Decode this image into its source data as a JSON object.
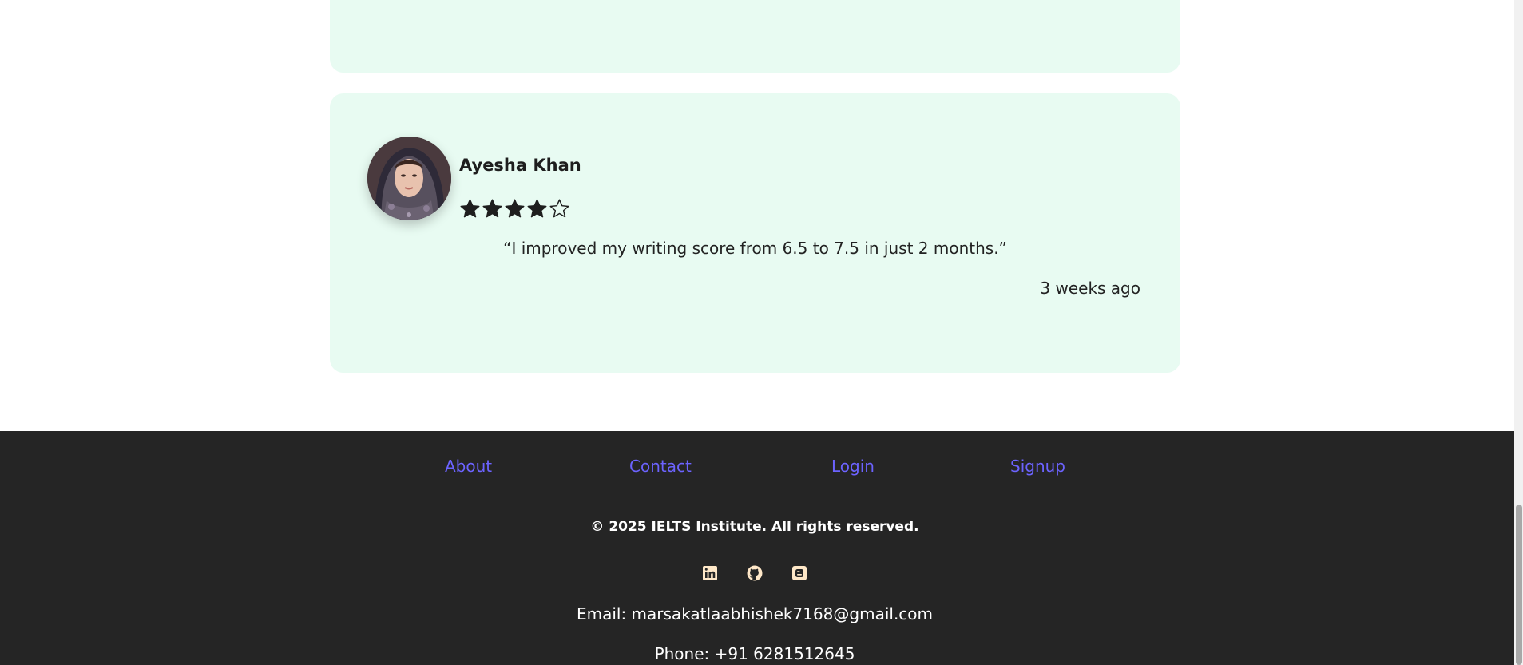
{
  "review": {
    "name": "Ayesha Khan",
    "rating": 4,
    "rating_max": 5,
    "quote": "“I improved my writing score from 6.5 to 7.5 in just 2 months.”",
    "time": "3 weeks ago",
    "avatar_icon": "avatar-photo"
  },
  "footer": {
    "links": [
      "About",
      "Contact",
      "Login",
      "Signup"
    ],
    "copyright": "© 2025 IELTS Institute. All rights reserved.",
    "socials": [
      "linkedin-icon",
      "github-icon",
      "blogger-icon"
    ],
    "email": "Email: marsakatlaabhishek7168@gmail.com",
    "phone": "Phone: +91 6281512645"
  },
  "colors": {
    "card_bg": "#e8fbf2",
    "footer_bg": "#252525",
    "link": "#6c63ff",
    "social_icon_bg": "#ffe8c8"
  }
}
